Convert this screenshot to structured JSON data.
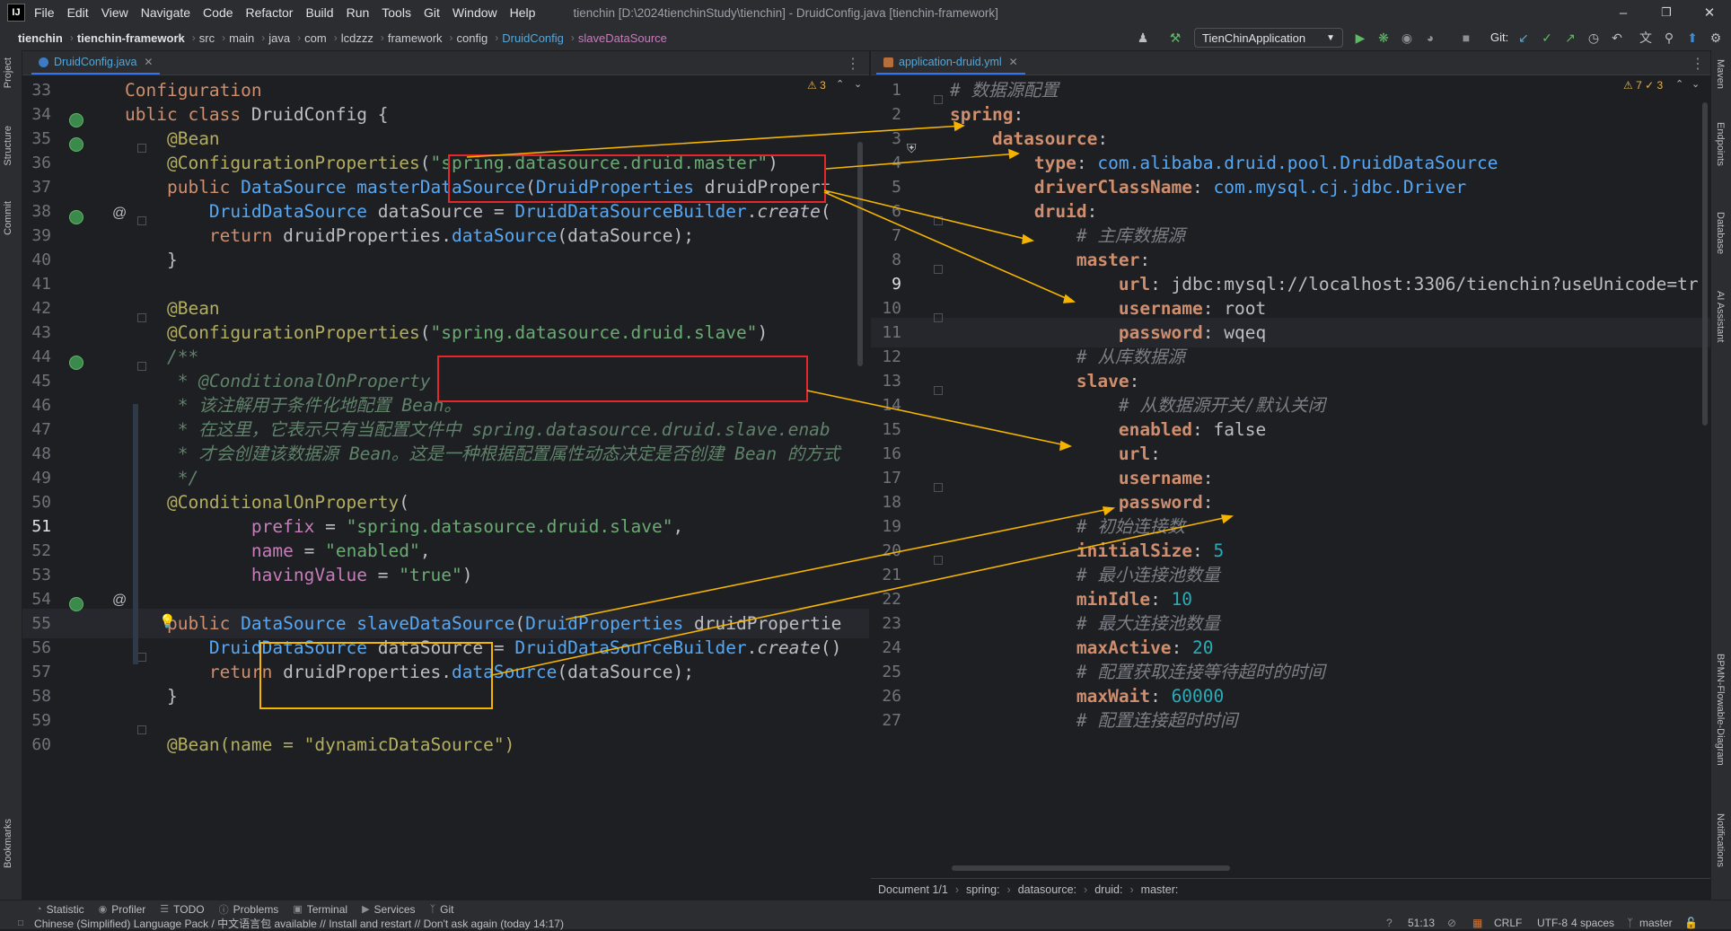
{
  "app": {
    "logo": "IJ",
    "window_title": "tienchin [D:\\2024tienchinStudy\\tienchin] - DruidConfig.java [tienchin-framework]"
  },
  "menu": [
    "File",
    "Edit",
    "View",
    "Navigate",
    "Code",
    "Refactor",
    "Build",
    "Run",
    "Tools",
    "Git",
    "Window",
    "Help"
  ],
  "window_controls": {
    "minimize": "–",
    "maximize": "❐",
    "close": "✕"
  },
  "breadcrumb": [
    "tienchin",
    "tienchin-framework",
    "src",
    "main",
    "java",
    "com",
    "lcdzzz",
    "framework",
    "config",
    "DruidConfig",
    "slaveDataSource"
  ],
  "run_config": "TienChinApplication",
  "git_label": "Git:",
  "left_tools": [
    "Project",
    "Structure",
    "Commit",
    "Bookmarks"
  ],
  "right_tools": [
    "Maven",
    "Endpoints",
    "Database",
    "AI Assistant",
    "BPMN-Flowable-Diagram",
    "Notifications"
  ],
  "left_editor": {
    "tab": "DruidConfig.java",
    "inspections": "⚠ 3",
    "lines": [
      {
        "n": "33",
        "segs": [
          [
            "kw",
            "Configuration"
          ]
        ]
      },
      {
        "n": "34",
        "segs": [
          [
            "kw",
            "ublic class "
          ],
          [
            "plain",
            "DruidConfig {"
          ]
        ]
      },
      {
        "n": "35",
        "segs": [
          [
            "plain",
            "    "
          ],
          [
            "ann",
            "@Bean"
          ]
        ]
      },
      {
        "n": "36",
        "segs": [
          [
            "plain",
            "    "
          ],
          [
            "ann",
            "@ConfigurationProperties"
          ],
          [
            "plain",
            "("
          ],
          [
            "str",
            "\"spring.datasource.druid.master\""
          ],
          [
            "plain",
            ")"
          ]
        ]
      },
      {
        "n": "37",
        "segs": [
          [
            "plain",
            "    "
          ],
          [
            "kw",
            "public "
          ],
          [
            "fn",
            "DataSource "
          ],
          [
            "fn",
            "masterDataSource"
          ],
          [
            "plain",
            "("
          ],
          [
            "fn",
            "DruidProperties "
          ],
          [
            "plain",
            "druidPropert"
          ]
        ]
      },
      {
        "n": "38",
        "segs": [
          [
            "plain",
            "        "
          ],
          [
            "fn",
            "DruidDataSource "
          ],
          [
            "plain",
            "dataSource = "
          ],
          [
            "fn",
            "DruidDataSourceBuilder"
          ],
          [
            "plain",
            "."
          ],
          [
            "itl",
            "create"
          ],
          [
            "plain",
            "("
          ]
        ]
      },
      {
        "n": "39",
        "segs": [
          [
            "plain",
            "        "
          ],
          [
            "kw",
            "return "
          ],
          [
            "plain",
            "druidProperties."
          ],
          [
            "fn",
            "dataSource"
          ],
          [
            "plain",
            "(dataSource);"
          ]
        ]
      },
      {
        "n": "40",
        "segs": [
          [
            "plain",
            "    }"
          ]
        ]
      },
      {
        "n": "41",
        "segs": [
          [
            "plain",
            ""
          ]
        ]
      },
      {
        "n": "42",
        "segs": [
          [
            "plain",
            "    "
          ],
          [
            "ann",
            "@Bean"
          ]
        ]
      },
      {
        "n": "43",
        "segs": [
          [
            "plain",
            "    "
          ],
          [
            "ann",
            "@ConfigurationProperties"
          ],
          [
            "plain",
            "("
          ],
          [
            "str",
            "\"spring.datasource.druid.slave\""
          ],
          [
            "plain",
            ")"
          ]
        ]
      },
      {
        "n": "44",
        "segs": [
          [
            "plain",
            "    "
          ],
          [
            "cm",
            "/**"
          ]
        ]
      },
      {
        "n": "45",
        "segs": [
          [
            "plain",
            "     "
          ],
          [
            "cm",
            "* @ConditionalOnProperty"
          ]
        ]
      },
      {
        "n": "46",
        "segs": [
          [
            "plain",
            "     "
          ],
          [
            "cm",
            "* 该注解用于条件化地配置 Bean。"
          ]
        ]
      },
      {
        "n": "47",
        "segs": [
          [
            "plain",
            "     "
          ],
          [
            "cm",
            "* 在这里，它表示只有当配置文件中 spring.datasource.druid.slave.enab"
          ]
        ]
      },
      {
        "n": "48",
        "segs": [
          [
            "plain",
            "     "
          ],
          [
            "cm",
            "* 才会创建该数据源 Bean。这是一种根据配置属性动态决定是否创建 Bean 的方式"
          ]
        ]
      },
      {
        "n": "49",
        "segs": [
          [
            "plain",
            "     "
          ],
          [
            "cm",
            "*/"
          ]
        ]
      },
      {
        "n": "50",
        "segs": [
          [
            "plain",
            "    "
          ],
          [
            "ann",
            "@ConditionalOnProperty"
          ],
          [
            "plain",
            "("
          ]
        ]
      },
      {
        "n": "51",
        "segs": [
          [
            "plain",
            "            "
          ],
          [
            "fld",
            "prefix"
          ],
          [
            "plain",
            " = "
          ],
          [
            "str",
            "\"spring.datasource.druid.slave\""
          ],
          [
            "plain",
            ","
          ]
        ]
      },
      {
        "n": "52",
        "segs": [
          [
            "plain",
            "            "
          ],
          [
            "fld",
            "name"
          ],
          [
            "plain",
            " = "
          ],
          [
            "str",
            "\"enabled\""
          ],
          [
            "plain",
            ","
          ]
        ]
      },
      {
        "n": "53",
        "segs": [
          [
            "plain",
            "            "
          ],
          [
            "fld",
            "havingValue"
          ],
          [
            "plain",
            " = "
          ],
          [
            "str",
            "\"true\""
          ],
          [
            "plain",
            ")"
          ]
        ]
      },
      {
        "n": "54",
        "segs": [
          [
            "plain",
            ""
          ]
        ]
      },
      {
        "n": "55",
        "segs": [
          [
            "plain",
            "    "
          ],
          [
            "kw",
            "public "
          ],
          [
            "fn",
            "DataSource "
          ],
          [
            "fn",
            "slaveDataSource"
          ],
          [
            "plain",
            "("
          ],
          [
            "fn",
            "DruidProperties "
          ],
          [
            "plain",
            "druidPropertie"
          ]
        ]
      },
      {
        "n": "56",
        "segs": [
          [
            "plain",
            "        "
          ],
          [
            "fn",
            "DruidDataSource "
          ],
          [
            "plain",
            "dataSource = "
          ],
          [
            "fn",
            "DruidDataSourceBuilder"
          ],
          [
            "plain",
            "."
          ],
          [
            "itl",
            "create"
          ],
          [
            "plain",
            "()"
          ]
        ]
      },
      {
        "n": "57",
        "segs": [
          [
            "plain",
            "        "
          ],
          [
            "kw",
            "return "
          ],
          [
            "plain",
            "druidProperties."
          ],
          [
            "fn",
            "dataSource"
          ],
          [
            "plain",
            "(dataSource);"
          ]
        ]
      },
      {
        "n": "58",
        "segs": [
          [
            "plain",
            "    }"
          ]
        ]
      },
      {
        "n": "59",
        "segs": [
          [
            "plain",
            ""
          ]
        ]
      },
      {
        "n": "60",
        "segs": [
          [
            "plain",
            "    "
          ],
          [
            "ann",
            "@Bean(name = \"dynamicDataSource\")"
          ]
        ]
      }
    ]
  },
  "right_editor": {
    "tab": "application-druid.yml",
    "inspections": "⚠ 7  ✓ 3",
    "lines": [
      {
        "n": "1",
        "segs": [
          [
            "ycm",
            "# 数据源配置"
          ]
        ]
      },
      {
        "n": "2",
        "segs": [
          [
            "ykey",
            "spring"
          ],
          [
            "yval",
            ":"
          ]
        ]
      },
      {
        "n": "3",
        "segs": [
          [
            "yval",
            "    "
          ],
          [
            "ykey",
            "datasource"
          ],
          [
            "yval",
            ":"
          ]
        ]
      },
      {
        "n": "4",
        "segs": [
          [
            "yval",
            "        "
          ],
          [
            "ykey",
            "type"
          ],
          [
            "yval",
            ": "
          ],
          [
            "ycls",
            "com.alibaba.druid.pool.DruidDataSource"
          ]
        ]
      },
      {
        "n": "5",
        "segs": [
          [
            "yval",
            "        "
          ],
          [
            "ykey",
            "driverClassName"
          ],
          [
            "yval",
            ": "
          ],
          [
            "ycls",
            "com.mysql.cj.jdbc.Driver"
          ]
        ]
      },
      {
        "n": "6",
        "segs": [
          [
            "yval",
            "        "
          ],
          [
            "ykey",
            "druid"
          ],
          [
            "yval",
            ":"
          ]
        ]
      },
      {
        "n": "7",
        "segs": [
          [
            "yval",
            "            "
          ],
          [
            "ycm",
            "# 主库数据源"
          ]
        ]
      },
      {
        "n": "8",
        "segs": [
          [
            "yval",
            "            "
          ],
          [
            "ykey",
            "master"
          ],
          [
            "yval",
            ":"
          ]
        ]
      },
      {
        "n": "9",
        "segs": [
          [
            "yval",
            "                "
          ],
          [
            "ykey",
            "url"
          ],
          [
            "yval",
            ": jdbc:mysql://localhost:3306/tienchin?useUnicode=tr"
          ]
        ]
      },
      {
        "n": "10",
        "segs": [
          [
            "yval",
            "                "
          ],
          [
            "ykey",
            "username"
          ],
          [
            "yval",
            ": root"
          ]
        ]
      },
      {
        "n": "11",
        "segs": [
          [
            "yval",
            "                "
          ],
          [
            "ykey",
            "password"
          ],
          [
            "yval",
            ": wqeq"
          ]
        ]
      },
      {
        "n": "12",
        "segs": [
          [
            "yval",
            "            "
          ],
          [
            "ycm",
            "# 从库数据源"
          ]
        ]
      },
      {
        "n": "13",
        "segs": [
          [
            "yval",
            "            "
          ],
          [
            "ykey",
            "slave"
          ],
          [
            "yval",
            ":"
          ]
        ]
      },
      {
        "n": "14",
        "segs": [
          [
            "yval",
            "                "
          ],
          [
            "ycm",
            "# 从数据源开关/默认关闭"
          ]
        ]
      },
      {
        "n": "15",
        "segs": [
          [
            "yval",
            "                "
          ],
          [
            "ykey",
            "enabled"
          ],
          [
            "yval",
            ": false"
          ]
        ]
      },
      {
        "n": "16",
        "segs": [
          [
            "yval",
            "                "
          ],
          [
            "ykey",
            "url"
          ],
          [
            "yval",
            ":"
          ]
        ]
      },
      {
        "n": "17",
        "segs": [
          [
            "yval",
            "                "
          ],
          [
            "ykey",
            "username"
          ],
          [
            "yval",
            ":"
          ]
        ]
      },
      {
        "n": "18",
        "segs": [
          [
            "yval",
            "                "
          ],
          [
            "ykey",
            "password"
          ],
          [
            "yval",
            ":"
          ]
        ]
      },
      {
        "n": "19",
        "segs": [
          [
            "yval",
            "            "
          ],
          [
            "ycm",
            "# 初始连接数"
          ]
        ]
      },
      {
        "n": "20",
        "segs": [
          [
            "yval",
            "            "
          ],
          [
            "ykey",
            "initialSize"
          ],
          [
            "yval",
            ": "
          ],
          [
            "ynum",
            "5"
          ]
        ]
      },
      {
        "n": "21",
        "segs": [
          [
            "yval",
            "            "
          ],
          [
            "ycm",
            "# 最小连接池数量"
          ]
        ]
      },
      {
        "n": "22",
        "segs": [
          [
            "yval",
            "            "
          ],
          [
            "ykey",
            "minIdle"
          ],
          [
            "yval",
            ": "
          ],
          [
            "ynum",
            "10"
          ]
        ]
      },
      {
        "n": "23",
        "segs": [
          [
            "yval",
            "            "
          ],
          [
            "ycm",
            "# 最大连接池数量"
          ]
        ]
      },
      {
        "n": "24",
        "segs": [
          [
            "yval",
            "            "
          ],
          [
            "ykey",
            "maxActive"
          ],
          [
            "yval",
            ": "
          ],
          [
            "ynum",
            "20"
          ]
        ]
      },
      {
        "n": "25",
        "segs": [
          [
            "yval",
            "            "
          ],
          [
            "ycm",
            "# 配置获取连接等待超时的时间"
          ]
        ]
      },
      {
        "n": "26",
        "segs": [
          [
            "yval",
            "            "
          ],
          [
            "ykey",
            "maxWait"
          ],
          [
            "yval",
            ": "
          ],
          [
            "ynum",
            "60000"
          ]
        ]
      },
      {
        "n": "27",
        "segs": [
          [
            "yval",
            "            "
          ],
          [
            "ycm",
            "# 配置连接超时时间"
          ]
        ]
      }
    ],
    "breadcrumb": [
      "Document 1/1",
      "spring:",
      "datasource:",
      "druid:",
      "master:"
    ]
  },
  "bottom_tools": [
    "Statistic",
    "Profiler",
    "TODO",
    "Problems",
    "Terminal",
    "Services",
    "Git"
  ],
  "status": {
    "message": "Chinese (Simplified) Language Pack / 中文语言包 available // Install and restart // Don't ask again (today 14:17)",
    "position": "51:13",
    "line_sep": "CRLF",
    "encoding": "UTF-8",
    "indent": "4 spaces",
    "branch": "master"
  },
  "colors": {
    "highlight_red": "#e5262b",
    "highlight_orange": "#f5b400",
    "accent": "#3574f0"
  }
}
